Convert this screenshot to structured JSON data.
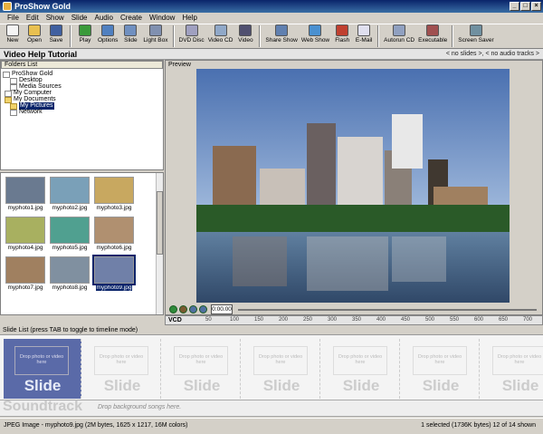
{
  "window": {
    "title": "ProShow Gold",
    "min": "_",
    "max": "□",
    "close": "×"
  },
  "menu": [
    "File",
    "Edit",
    "Show",
    "Slide",
    "Audio",
    "Create",
    "Window",
    "Help"
  ],
  "toolbar": [
    {
      "label": "New",
      "icon": "new-icon",
      "color": "#f4f4f4"
    },
    {
      "label": "Open",
      "icon": "open-icon",
      "color": "#e8c050"
    },
    {
      "label": "Save",
      "icon": "save-icon",
      "color": "#4060a0"
    },
    {
      "label": "Play",
      "icon": "play-icon",
      "color": "#3a9a3a"
    },
    {
      "label": "Options",
      "icon": "options-icon",
      "color": "#5080c0"
    },
    {
      "label": "Slide",
      "icon": "slide-icon",
      "color": "#7090c0"
    },
    {
      "label": "Light Box",
      "icon": "lightbox-icon",
      "color": "#8090b0"
    },
    {
      "label": "DVD Disc",
      "icon": "dvd-icon",
      "color": "#a0a0c0"
    },
    {
      "label": "Video CD",
      "icon": "videocd-icon",
      "color": "#90a8c8"
    },
    {
      "label": "Video",
      "icon": "video-icon",
      "color": "#505070"
    },
    {
      "label": "Share Show",
      "icon": "share-icon",
      "color": "#6080b0"
    },
    {
      "label": "Web Show",
      "icon": "webshow-icon",
      "color": "#4a90d0"
    },
    {
      "label": "Flash",
      "icon": "flash-icon",
      "color": "#c04030"
    },
    {
      "label": "E-Mail",
      "icon": "email-icon",
      "color": "#e0e0f0"
    },
    {
      "label": "Autorun CD",
      "icon": "autorun-icon",
      "color": "#90a0c0"
    },
    {
      "label": "Executable",
      "icon": "executable-icon",
      "color": "#a05050"
    },
    {
      "label": "Screen Saver",
      "icon": "screensaver-icon",
      "color": "#7090a0"
    }
  ],
  "header": {
    "title": "Video Help Tutorial",
    "status": "< no slides >, < no audio tracks >"
  },
  "folders": {
    "heading": "Folders List",
    "items": [
      {
        "label": "ProShow Gold",
        "icon": "app-icon"
      },
      {
        "label": "Desktop",
        "icon": "desktop-icon"
      },
      {
        "label": "Media Sources",
        "icon": "media-icon"
      },
      {
        "label": "My Computer",
        "icon": "computer-icon"
      },
      {
        "label": "My Documents",
        "icon": "folder-icon"
      },
      {
        "label": "My Pictures",
        "icon": "folder-icon"
      },
      {
        "label": "Network",
        "icon": "network-icon"
      }
    ]
  },
  "files": [
    {
      "name": "myphoto1.jpg",
      "color": "#6a7a90"
    },
    {
      "name": "myphoto2.jpg",
      "color": "#7aa0b8"
    },
    {
      "name": "myphoto3.jpg",
      "color": "#c8a860"
    },
    {
      "name": "myphoto4.jpg",
      "color": "#a8b060"
    },
    {
      "name": "myphoto5.jpg",
      "color": "#50a090"
    },
    {
      "name": "myphoto6.jpg",
      "color": "#b09070"
    },
    {
      "name": "myphoto7.jpg",
      "color": "#a08060"
    },
    {
      "name": "myphoto8.jpg",
      "color": "#8090a0"
    },
    {
      "name": "myphoto9.jpg",
      "color": "#7080a8"
    }
  ],
  "preview": {
    "heading": "Preview",
    "timecode": "0:00.00"
  },
  "timeline": {
    "label": "VCD",
    "ticks": [
      "50",
      "100",
      "150",
      "200",
      "250",
      "300",
      "350",
      "400",
      "450",
      "500",
      "550",
      "600",
      "650",
      "700"
    ]
  },
  "slidelist": {
    "bar": "Slide List (press TAB to toggle to timeline mode)",
    "drop_text": "Drop photo or video here",
    "slide_label": "Slide"
  },
  "soundtrack": {
    "label": "Soundtrack",
    "drop": "Drop background songs here."
  },
  "status": {
    "left": "JPEG Image - myphoto9.jpg  (2M bytes, 1625 x 1217, 16M colors)",
    "right": "1 selected (1736K bytes) 12 of 14 shown"
  }
}
